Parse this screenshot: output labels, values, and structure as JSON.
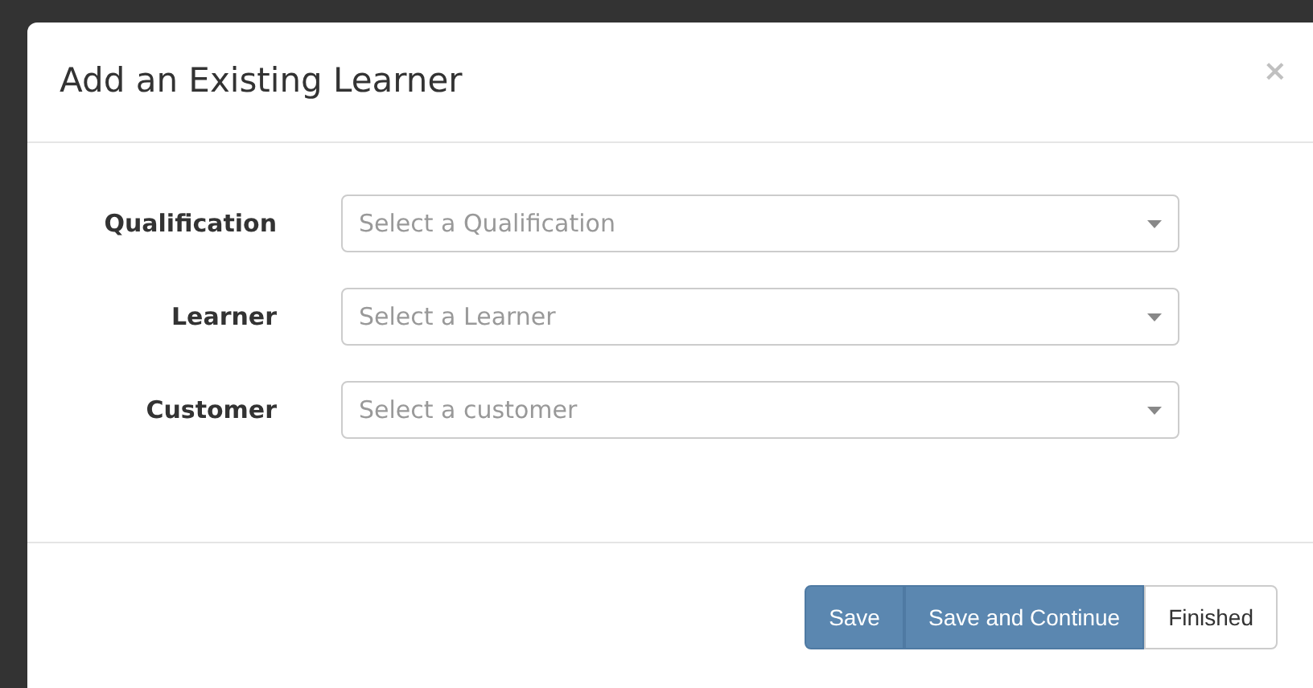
{
  "dialog": {
    "title": "Add an Existing Learner",
    "close": "×"
  },
  "fields": [
    {
      "label": "Qualification",
      "placeholder": "Select a Qualification"
    },
    {
      "label": "Learner",
      "placeholder": "Select a Learner"
    },
    {
      "label": "Customer",
      "placeholder": "Select a customer"
    }
  ],
  "buttons": [
    {
      "label": "Save",
      "kind": "primary"
    },
    {
      "label": "Save and Continue",
      "kind": "primary"
    },
    {
      "label": "Finished",
      "kind": "default"
    }
  ]
}
